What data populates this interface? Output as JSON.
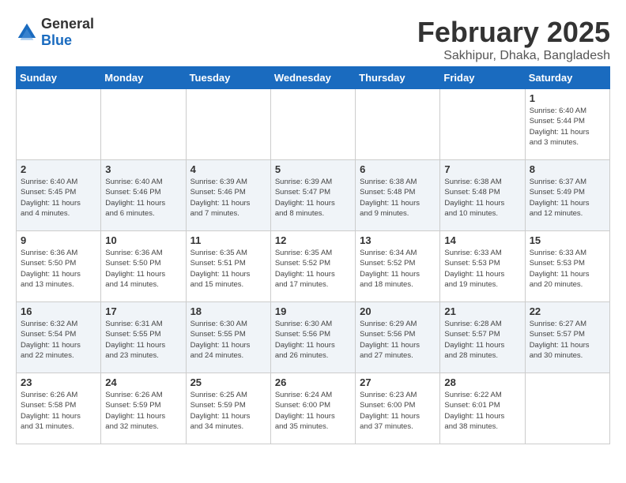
{
  "logo": {
    "text_general": "General",
    "text_blue": "Blue"
  },
  "header": {
    "month": "February 2025",
    "location": "Sakhipur, Dhaka, Bangladesh"
  },
  "weekdays": [
    "Sunday",
    "Monday",
    "Tuesday",
    "Wednesday",
    "Thursday",
    "Friday",
    "Saturday"
  ],
  "weeks": [
    [
      {
        "day": "",
        "info": ""
      },
      {
        "day": "",
        "info": ""
      },
      {
        "day": "",
        "info": ""
      },
      {
        "day": "",
        "info": ""
      },
      {
        "day": "",
        "info": ""
      },
      {
        "day": "",
        "info": ""
      },
      {
        "day": "1",
        "info": "Sunrise: 6:40 AM\nSunset: 5:44 PM\nDaylight: 11 hours\nand 3 minutes."
      }
    ],
    [
      {
        "day": "2",
        "info": "Sunrise: 6:40 AM\nSunset: 5:45 PM\nDaylight: 11 hours\nand 4 minutes."
      },
      {
        "day": "3",
        "info": "Sunrise: 6:40 AM\nSunset: 5:46 PM\nDaylight: 11 hours\nand 6 minutes."
      },
      {
        "day": "4",
        "info": "Sunrise: 6:39 AM\nSunset: 5:46 PM\nDaylight: 11 hours\nand 7 minutes."
      },
      {
        "day": "5",
        "info": "Sunrise: 6:39 AM\nSunset: 5:47 PM\nDaylight: 11 hours\nand 8 minutes."
      },
      {
        "day": "6",
        "info": "Sunrise: 6:38 AM\nSunset: 5:48 PM\nDaylight: 11 hours\nand 9 minutes."
      },
      {
        "day": "7",
        "info": "Sunrise: 6:38 AM\nSunset: 5:48 PM\nDaylight: 11 hours\nand 10 minutes."
      },
      {
        "day": "8",
        "info": "Sunrise: 6:37 AM\nSunset: 5:49 PM\nDaylight: 11 hours\nand 12 minutes."
      }
    ],
    [
      {
        "day": "9",
        "info": "Sunrise: 6:36 AM\nSunset: 5:50 PM\nDaylight: 11 hours\nand 13 minutes."
      },
      {
        "day": "10",
        "info": "Sunrise: 6:36 AM\nSunset: 5:50 PM\nDaylight: 11 hours\nand 14 minutes."
      },
      {
        "day": "11",
        "info": "Sunrise: 6:35 AM\nSunset: 5:51 PM\nDaylight: 11 hours\nand 15 minutes."
      },
      {
        "day": "12",
        "info": "Sunrise: 6:35 AM\nSunset: 5:52 PM\nDaylight: 11 hours\nand 17 minutes."
      },
      {
        "day": "13",
        "info": "Sunrise: 6:34 AM\nSunset: 5:52 PM\nDaylight: 11 hours\nand 18 minutes."
      },
      {
        "day": "14",
        "info": "Sunrise: 6:33 AM\nSunset: 5:53 PM\nDaylight: 11 hours\nand 19 minutes."
      },
      {
        "day": "15",
        "info": "Sunrise: 6:33 AM\nSunset: 5:53 PM\nDaylight: 11 hours\nand 20 minutes."
      }
    ],
    [
      {
        "day": "16",
        "info": "Sunrise: 6:32 AM\nSunset: 5:54 PM\nDaylight: 11 hours\nand 22 minutes."
      },
      {
        "day": "17",
        "info": "Sunrise: 6:31 AM\nSunset: 5:55 PM\nDaylight: 11 hours\nand 23 minutes."
      },
      {
        "day": "18",
        "info": "Sunrise: 6:30 AM\nSunset: 5:55 PM\nDaylight: 11 hours\nand 24 minutes."
      },
      {
        "day": "19",
        "info": "Sunrise: 6:30 AM\nSunset: 5:56 PM\nDaylight: 11 hours\nand 26 minutes."
      },
      {
        "day": "20",
        "info": "Sunrise: 6:29 AM\nSunset: 5:56 PM\nDaylight: 11 hours\nand 27 minutes."
      },
      {
        "day": "21",
        "info": "Sunrise: 6:28 AM\nSunset: 5:57 PM\nDaylight: 11 hours\nand 28 minutes."
      },
      {
        "day": "22",
        "info": "Sunrise: 6:27 AM\nSunset: 5:57 PM\nDaylight: 11 hours\nand 30 minutes."
      }
    ],
    [
      {
        "day": "23",
        "info": "Sunrise: 6:26 AM\nSunset: 5:58 PM\nDaylight: 11 hours\nand 31 minutes."
      },
      {
        "day": "24",
        "info": "Sunrise: 6:26 AM\nSunset: 5:59 PM\nDaylight: 11 hours\nand 32 minutes."
      },
      {
        "day": "25",
        "info": "Sunrise: 6:25 AM\nSunset: 5:59 PM\nDaylight: 11 hours\nand 34 minutes."
      },
      {
        "day": "26",
        "info": "Sunrise: 6:24 AM\nSunset: 6:00 PM\nDaylight: 11 hours\nand 35 minutes."
      },
      {
        "day": "27",
        "info": "Sunrise: 6:23 AM\nSunset: 6:00 PM\nDaylight: 11 hours\nand 37 minutes."
      },
      {
        "day": "28",
        "info": "Sunrise: 6:22 AM\nSunset: 6:01 PM\nDaylight: 11 hours\nand 38 minutes."
      },
      {
        "day": "",
        "info": ""
      }
    ]
  ],
  "accent_color": "#1a6bbf"
}
